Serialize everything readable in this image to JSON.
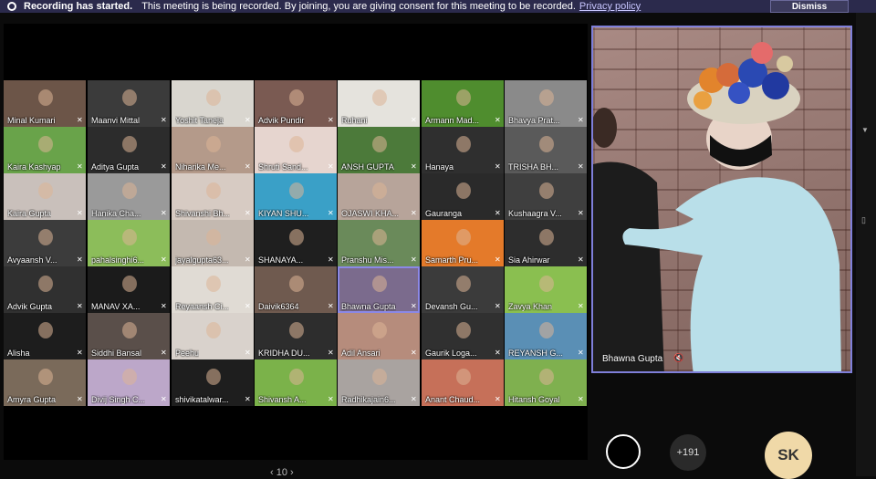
{
  "banner": {
    "title": "Recording has started.",
    "message": "This meeting is being recorded. By joining, you are giving consent for this meeting to be recorded.",
    "link": "Privacy policy",
    "dismiss": "Dismiss"
  },
  "participants": [
    "Minal Kumari",
    "Maanvi Mittal",
    "Yoshit Taneja",
    "Advik Pundir",
    "Ruhani",
    "Armann Mad...",
    "Bhavya Prat...",
    "Kaira Kashyap",
    "Aditya Gupta",
    "Niharika Me...",
    "Shruti Sand...",
    "ANSH GUPTA",
    "Hanaya",
    "TRISHA BH...",
    "Kaira Gupta",
    "Hanika Cha...",
    "Shivanshi Bh...",
    "KIYAN SHU...",
    "OJASWI KHA...",
    "Gauranga",
    "Kushaagra V...",
    "Avyaansh V...",
    "pahalsinghi6...",
    "jayalgupta63...",
    "SHANAYA...",
    "Pranshu Mis...",
    "Samarth Pru...",
    "Sia Ahirwar",
    "Advik Gupta",
    "MANAV XA...",
    "Reyaansh Ci...",
    "Daivik6364",
    "Bhawna Gupta",
    "Devansh Gu...",
    "Zavya Khan",
    "Alisha",
    "Siddhi Bansal",
    "Peehu",
    "KRIDHA DU...",
    "Adil Ansari",
    "Gaurik Loga...",
    "REYANSH G...",
    "Amyra Gupta",
    "Divij Singh C...",
    "shivikatalwar...",
    "Shivansh A...",
    "Radhikajain6...",
    "Anant Chaud...",
    "Hitansh Goyal"
  ],
  "spotlight": {
    "name": "Bhawna Gupta"
  },
  "bottom": {
    "more_count": "+191",
    "initials": "SK",
    "pager": "‹ 10 ›"
  },
  "colors": {
    "accent": "#7f7fd9",
    "banner": "#2b2a4c",
    "avatar_sk": "#f0d9a8"
  }
}
